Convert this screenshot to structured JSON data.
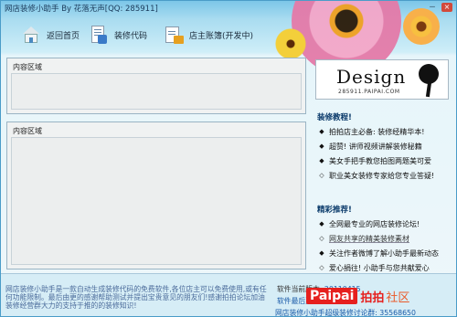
{
  "window": {
    "title": "网店装修小助手 By 花落无声[QQ: 285911]",
    "minimize_label": "－",
    "close_label": "×"
  },
  "toolbar": {
    "home_label": "返回首页",
    "code_label": "装修代码",
    "ledger_label": "店主账簿(开发中)"
  },
  "panels": {
    "top_label": "内容区域",
    "bottom_label": "内容区域"
  },
  "logo": {
    "text": "Design",
    "url": "285911.PAIPAI.COM"
  },
  "tutorials": {
    "title": "装修教程!",
    "items": [
      "拍拍店主必备: 装修经精华本!",
      "超赞! 讲师视频讲解装修秘籍",
      "美女手把手教您拍图两题美可爱",
      "职业美女装修专家给您专业答疑!"
    ]
  },
  "recommend": {
    "title": "精彩推荐!",
    "items": [
      "全网最专业的网店装修论坛!",
      "网友共享的精美装修素材",
      "关注作者微博了解小助手最新动态",
      "爱心捐往! 小助手与您共献爱心"
    ]
  },
  "footer": {
    "description": "网店装修小助手是一款自动生成装修代码的免费软件,各位店主可以免费使用,或有任何功能限制。最后由更的感谢帮助测试并提出宝贵意见的朋友们!感谢拍拍论坛加油装修经营群大力的支持于推的的装修知识!",
    "version_label": "软件当前版本:",
    "version_value": "20110415",
    "update_label": "软件最后更新:",
    "contact": "网店装修小助手超级装修讨论群: 35568650"
  },
  "brand": {
    "en": "Paipai",
    "cn": "拍拍",
    "community": "社区"
  },
  "colors": {
    "title_bar": "#7cc6e8",
    "accent_blue": "#1a5aa8",
    "brand_red": "#e6201e"
  }
}
